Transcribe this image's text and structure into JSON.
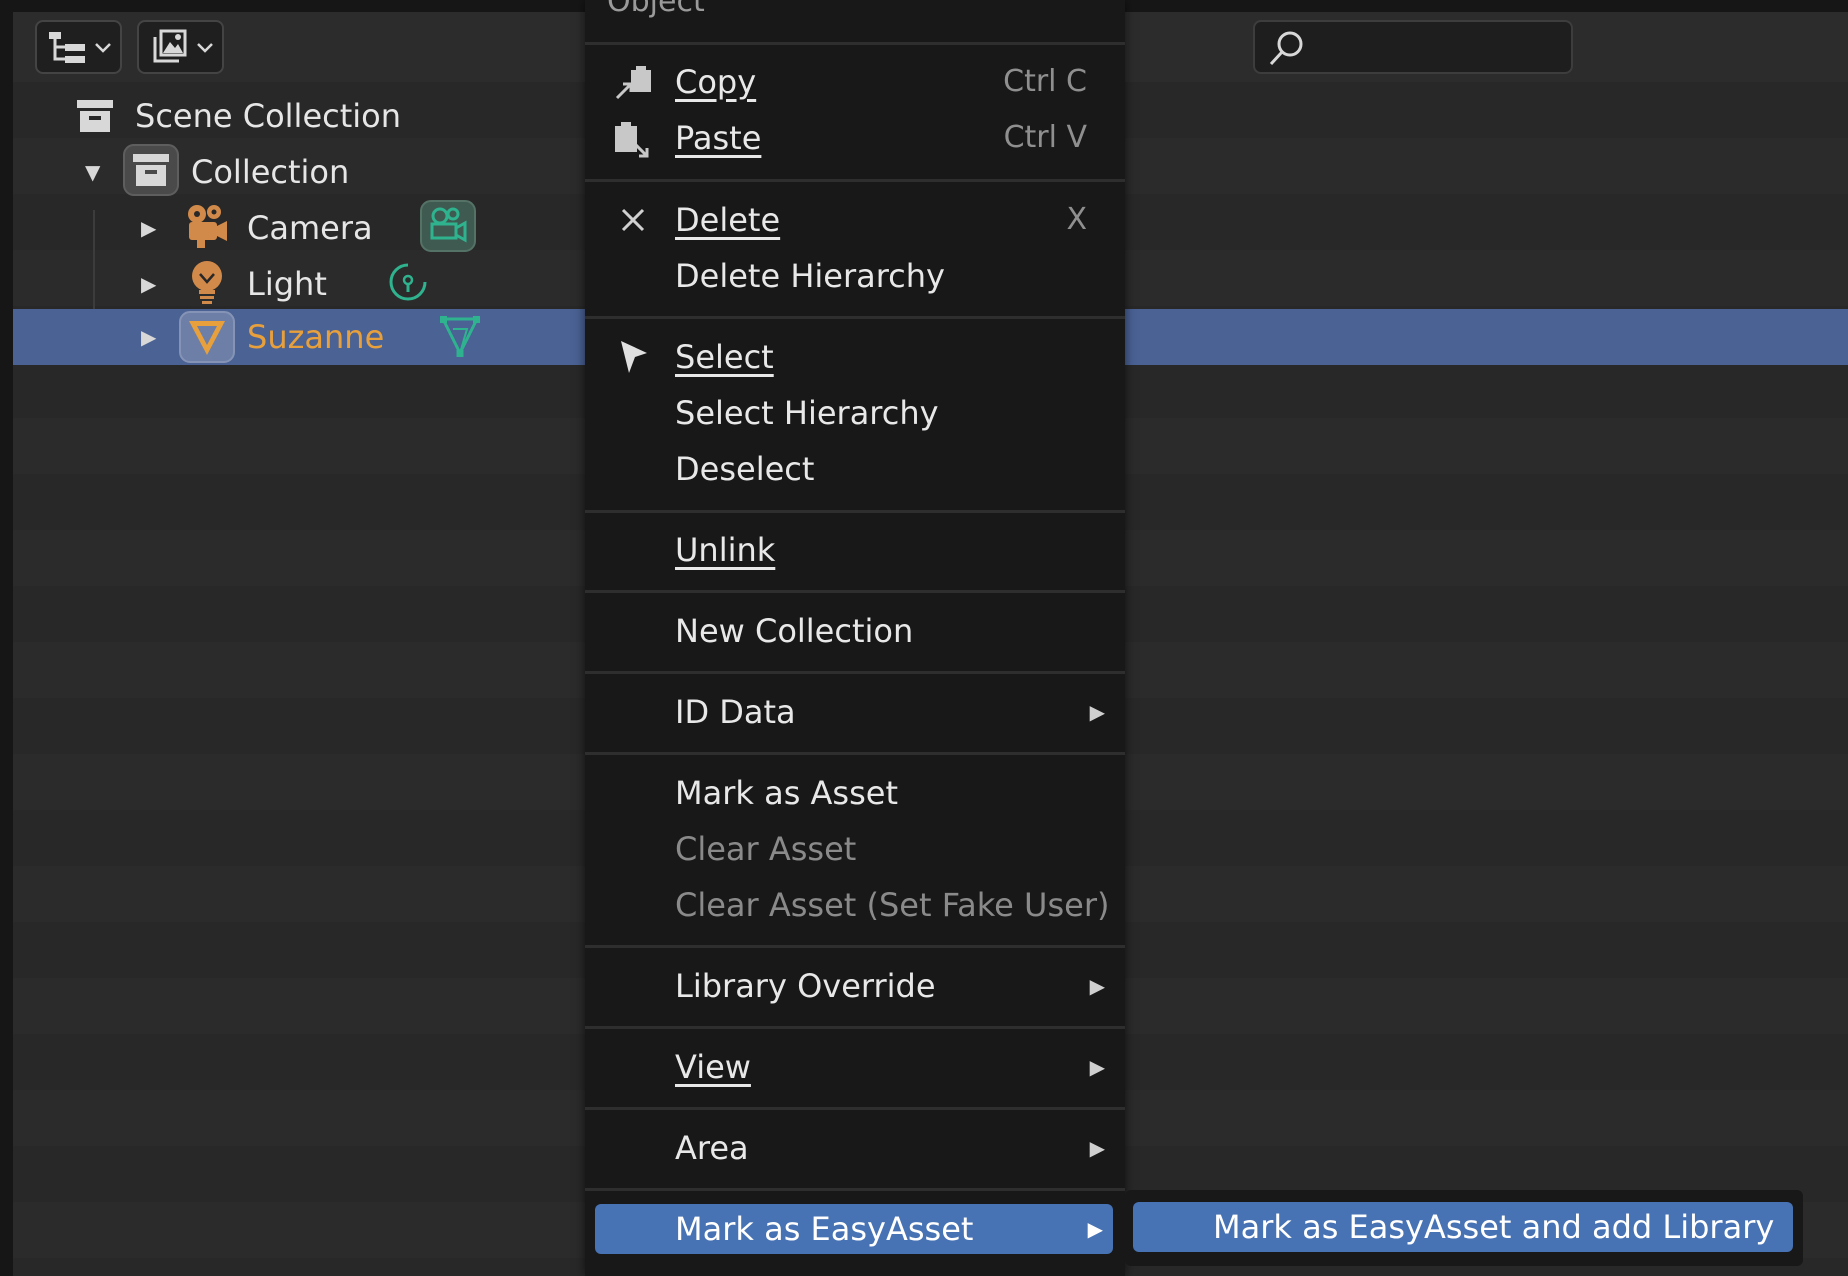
{
  "outliner": {
    "search": {
      "placeholder": ""
    },
    "tree": {
      "scene_collection": "Scene Collection",
      "collection": "Collection",
      "objects": [
        {
          "name": "Camera",
          "icon": "camera-icon",
          "data_icon": "camera-data-icon"
        },
        {
          "name": "Light",
          "icon": "light-icon",
          "data_icon": "light-data-icon"
        },
        {
          "name": "Suzanne",
          "icon": "mesh-icon",
          "data_icon": "mesh-data-icon",
          "selected": true
        }
      ]
    }
  },
  "context_menu": {
    "title": "Object",
    "items": {
      "copy": {
        "label": "Copy",
        "shortcut": "Ctrl C"
      },
      "paste": {
        "label": "Paste",
        "shortcut": "Ctrl V"
      },
      "delete": {
        "label": "Delete",
        "shortcut": "X"
      },
      "delete_hierarchy": {
        "label": "Delete Hierarchy"
      },
      "select": {
        "label": "Select"
      },
      "select_hierarchy": {
        "label": "Select Hierarchy"
      },
      "deselect": {
        "label": "Deselect"
      },
      "unlink": {
        "label": "Unlink"
      },
      "new_collection": {
        "label": "New Collection"
      },
      "id_data": {
        "label": "ID Data"
      },
      "mark_as_asset": {
        "label": "Mark as Asset"
      },
      "clear_asset": {
        "label": "Clear Asset"
      },
      "clear_asset_fake_user": {
        "label": "Clear Asset (Set Fake User)"
      },
      "library_override": {
        "label": "Library Override"
      },
      "view": {
        "label": "View"
      },
      "area": {
        "label": "Area"
      },
      "mark_as_easyasset": {
        "label": "Mark as EasyAsset"
      }
    }
  },
  "submenu": {
    "item": "Mark as EasyAsset and add Library"
  },
  "colors": {
    "selected_row": "#4a6294",
    "menu_highlight": "#4772b3",
    "object_orange": "#e8a03c",
    "data_green": "#2fb38f"
  }
}
